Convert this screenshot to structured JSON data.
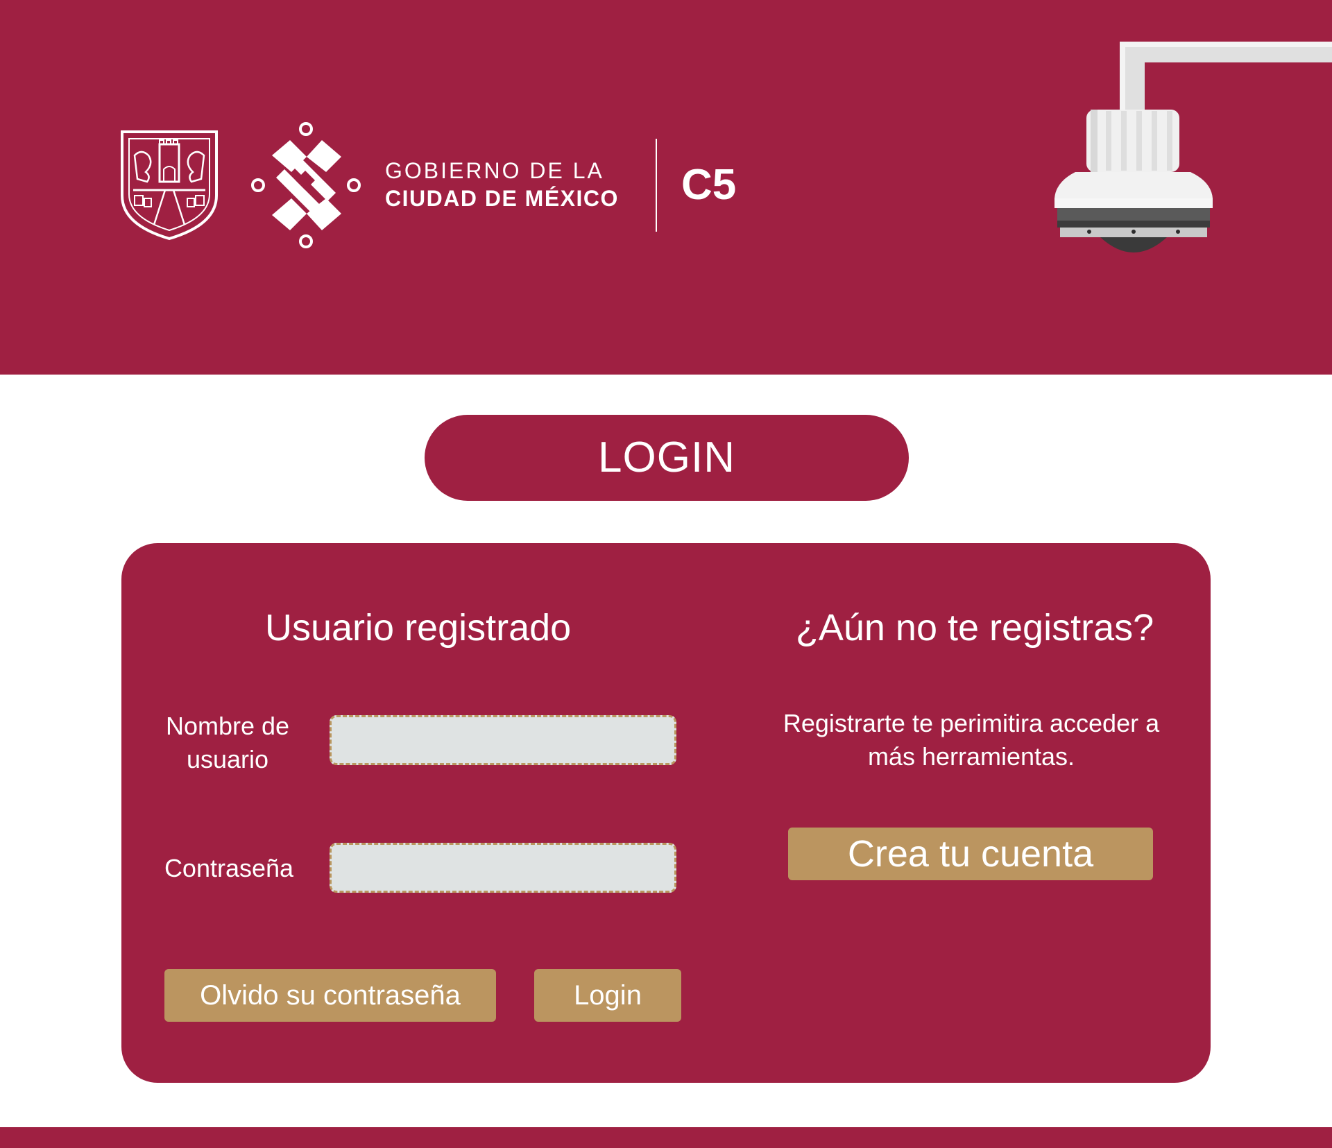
{
  "header": {
    "gov_line1": "GOBIERNO DE LA",
    "gov_line2": "CIUDAD DE MÉXICO",
    "unit": "C5",
    "shield_icon": "cdmx-shield-icon",
    "mark_icon": "cdmx-knot-logo-icon",
    "camera_icon": "security-dome-camera-icon"
  },
  "login_title": "LOGIN",
  "registered": {
    "heading": "Usuario registrado",
    "username_label": "Nombre de usuario",
    "username_value": "",
    "password_label": "Contraseña",
    "password_value": "",
    "forgot_button": "Olvido su contraseña",
    "login_button": "Login"
  },
  "signup": {
    "heading": "¿Aún no te registras?",
    "description": "Registrarte te perimitira acceder a más herramientas.",
    "create_button": "Crea tu cuenta"
  },
  "colors": {
    "primary": "#9f2042",
    "gold": "#bb9560",
    "input_bg": "#dfe3e3"
  }
}
